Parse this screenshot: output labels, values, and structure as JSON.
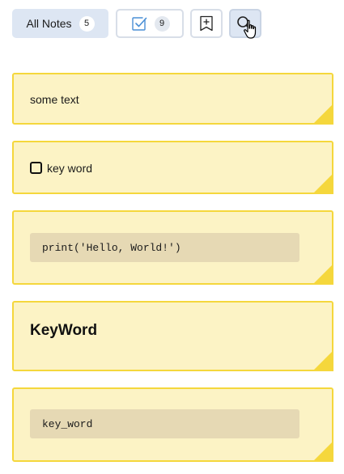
{
  "toolbar": {
    "all_notes_label": "All Notes",
    "all_notes_count": "5",
    "todo_count": "9"
  },
  "icons": {
    "todo": "checkbox-checked-icon",
    "new_note": "new-note-icon",
    "search": "search-icon",
    "cursor": "mouse-pointer-icon"
  },
  "notes": [
    {
      "type": "text",
      "text": "some text"
    },
    {
      "type": "checklist",
      "text": "key word",
      "checked": false
    },
    {
      "type": "code",
      "text": "print('Hello, World!')"
    },
    {
      "type": "heading",
      "text": "KeyWord"
    },
    {
      "type": "code",
      "text": "key_word"
    }
  ],
  "colors": {
    "note_background": "#fcf3c5",
    "note_border": "#f5d73c",
    "note_fold": "#f5d73c",
    "code_background": "#e6d9b4",
    "active_button": "#dde6f3",
    "button_border": "#d8dee8"
  }
}
